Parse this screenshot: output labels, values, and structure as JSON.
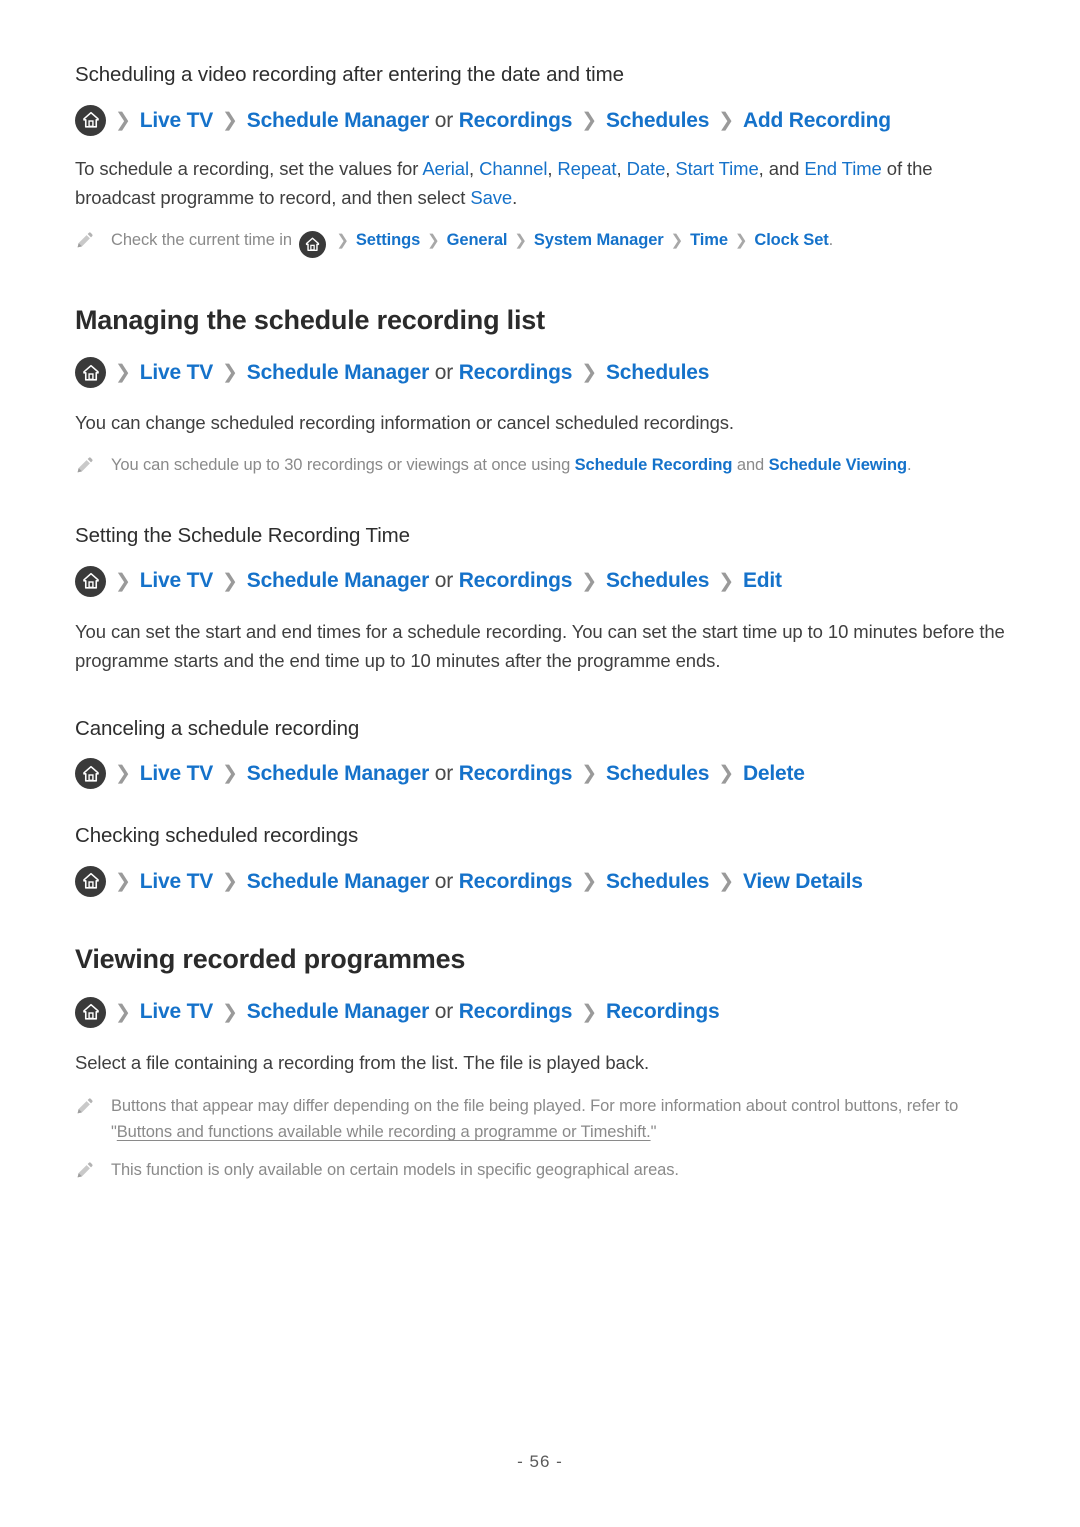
{
  "document": {
    "page_number": "- 56 -",
    "link_color": "#1572ca",
    "text_color": "#3f3f3f",
    "note_color": "#8a8a8a"
  },
  "sections": [
    {
      "id": "scheduling-after-date-time",
      "heading": "Scheduling a video recording after entering the date and time",
      "path": {
        "home_icon": "home-icon",
        "crumbs": [
          "Live TV",
          "Schedule Manager",
          "Recordings",
          "Schedules",
          "Add Recording"
        ],
        "joiner": "or"
      },
      "paragraph": {
        "p1": "To schedule a recording, set the values for ",
        "l1": "Aerial",
        "p2": ", ",
        "l2": "Channel",
        "p3": ", ",
        "l3": "Repeat",
        "p4": ", ",
        "l4": "Date",
        "p5": ", ",
        "l5": "Start Time",
        "p6": ", and ",
        "l6": "End Time",
        "p7": " of the broadcast programme to record, and then select ",
        "l7": "Save",
        "p8": "."
      },
      "note": {
        "icon": "pencil-icon",
        "t1": "Check the current time in ",
        "crumbs": [
          "Settings",
          "General",
          "System Manager",
          "Time",
          "Clock Set"
        ],
        "t2": "."
      }
    },
    {
      "id": "managing-schedule-recording-list",
      "heading": "Managing the schedule recording list",
      "path": {
        "home_icon": "home-icon",
        "crumbs": [
          "Live TV",
          "Schedule Manager",
          "Recordings",
          "Schedules"
        ],
        "joiner": "or"
      },
      "paragraph": "You can change scheduled recording information or cancel scheduled recordings.",
      "note": {
        "icon": "pencil-icon",
        "t1": "You can schedule up to 30 recordings or viewings at once using ",
        "l1": "Schedule Recording",
        "t2": " and ",
        "l2": "Schedule Viewing",
        "t3": "."
      }
    },
    {
      "id": "setting-schedule-recording-time",
      "heading": "Setting the Schedule Recording Time",
      "path": {
        "home_icon": "home-icon",
        "crumbs": [
          "Live TV",
          "Schedule Manager",
          "Recordings",
          "Schedules",
          "Edit"
        ],
        "joiner": "or"
      },
      "paragraph": "You can set the start and end times for a schedule recording. You can set the start time up to 10 minutes before the programme starts and the end time up to 10 minutes after the programme ends."
    },
    {
      "id": "canceling-schedule-recording",
      "heading": "Canceling a schedule recording",
      "path": {
        "home_icon": "home-icon",
        "crumbs": [
          "Live TV",
          "Schedule Manager",
          "Recordings",
          "Schedules",
          "Delete"
        ],
        "joiner": "or"
      }
    },
    {
      "id": "checking-scheduled-recordings",
      "heading": "Checking scheduled recordings",
      "path": {
        "home_icon": "home-icon",
        "crumbs": [
          "Live TV",
          "Schedule Manager",
          "Recordings",
          "Schedules",
          "View Details"
        ],
        "joiner": "or"
      }
    },
    {
      "id": "viewing-recorded-programmes",
      "heading": "Viewing recorded programmes",
      "path": {
        "home_icon": "home-icon",
        "crumbs": [
          "Live TV",
          "Schedule Manager",
          "Recordings",
          "Recordings"
        ],
        "joiner": "or"
      },
      "paragraph": "Select a file containing a recording from the list. The file is played back.",
      "notes": [
        {
          "icon": "pencil-icon",
          "t1": "Buttons that appear may differ depending on the file being played. For more information about control buttons, refer to ",
          "quote_open": "\"",
          "link": "Buttons and functions available while recording a programme or Timeshift.",
          "quote_close": "\""
        },
        {
          "icon": "pencil-icon",
          "t1": "This function is only available on certain models in specific geographical areas."
        }
      ]
    }
  ]
}
